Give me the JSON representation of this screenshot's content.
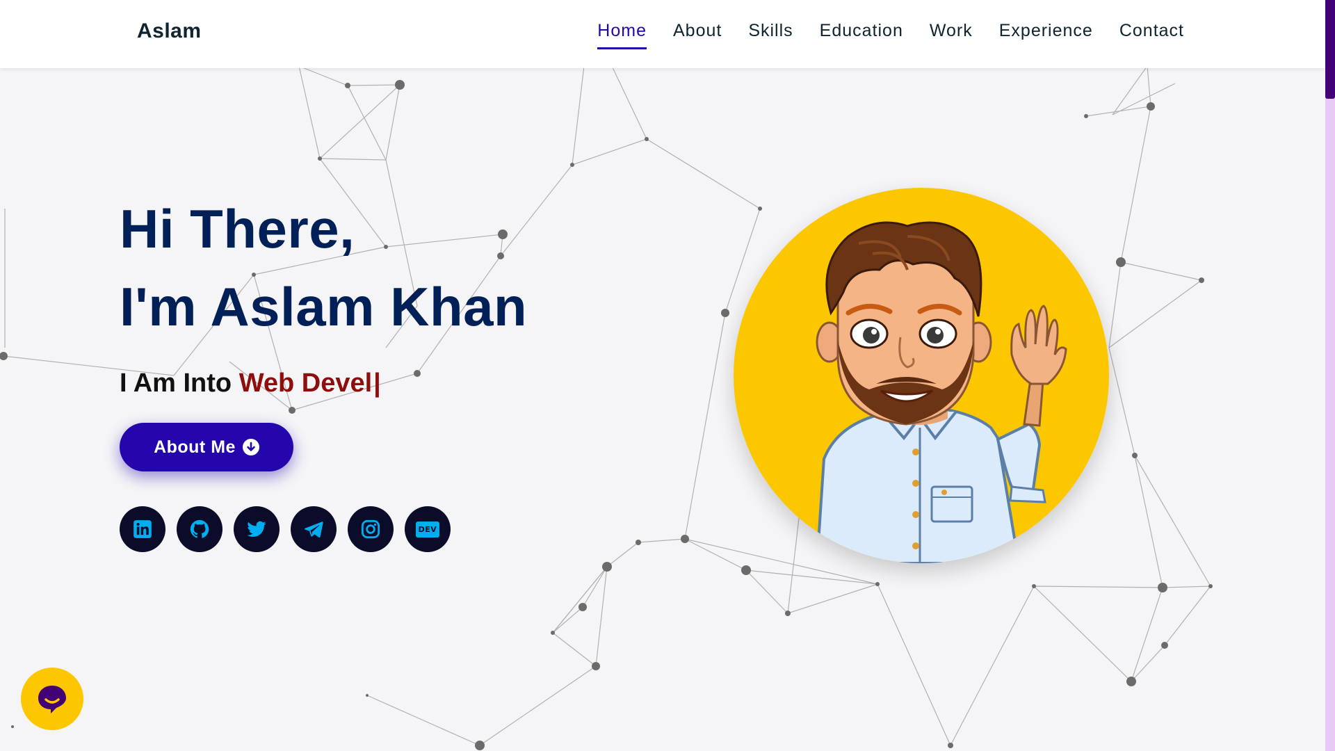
{
  "header": {
    "brand": "Aslam",
    "nav": [
      {
        "label": "Home",
        "active": true
      },
      {
        "label": "About",
        "active": false
      },
      {
        "label": "Skills",
        "active": false
      },
      {
        "label": "Education",
        "active": false
      },
      {
        "label": "Work",
        "active": false
      },
      {
        "label": "Experience",
        "active": false
      },
      {
        "label": "Contact",
        "active": false
      }
    ]
  },
  "hero": {
    "greeting": "Hi There,",
    "name": "I'm Aslam Khan",
    "typing_prefix": "I Am Into ",
    "typing_role": "Web Devel",
    "typing_cursor": "|",
    "button_label": "About Me",
    "socials": [
      {
        "name": "linkedin-icon"
      },
      {
        "name": "github-icon"
      },
      {
        "name": "twitter-icon"
      },
      {
        "name": "telegram-icon"
      },
      {
        "name": "instagram-icon"
      },
      {
        "name": "dev-icon",
        "badge": "DEV"
      }
    ]
  },
  "colors": {
    "brand": "#2506ad",
    "heading": "#002057",
    "role": "#8e0e0e",
    "avatar_bg": "#fdc700",
    "social_bg": "#0b0c29",
    "social_icon": "#00aeef"
  },
  "icons": {
    "button_arrow": "arrow-down-circle-icon",
    "chat": "chat-icon"
  }
}
